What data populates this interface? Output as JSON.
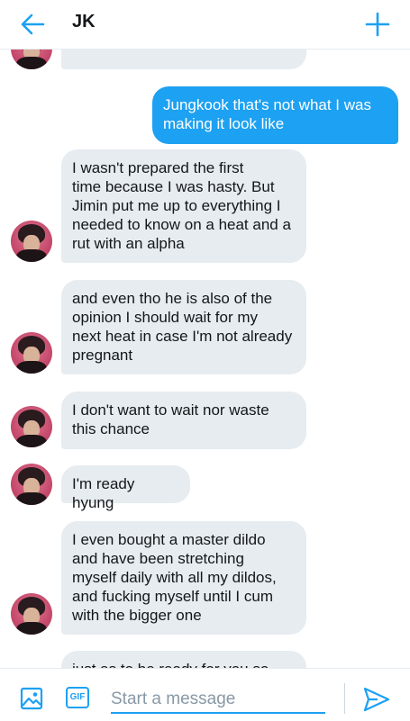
{
  "header": {
    "title": "JK"
  },
  "messages": [
    {
      "dir": "in",
      "text": ""
    },
    {
      "dir": "out",
      "text": "Jungkook that's not what I was\nmaking it look like"
    },
    {
      "dir": "in",
      "text": "I wasn't prepared the first\ntime because I was hasty. But\nJimin put me up to everything I\nneeded to know on a heat and a\nrut with an alpha"
    },
    {
      "dir": "in",
      "text": "and even tho he is also of the\nopinion I should wait for my\nnext heat in case I'm not already\npregnant"
    },
    {
      "dir": "in",
      "text": "I don't want to wait nor waste\nthis chance"
    },
    {
      "dir": "in",
      "text": "I'm ready hyung"
    },
    {
      "dir": "in",
      "text": "I even bought a master dildo\nand have been stretching\nmyself daily with all my dildos,\nand fucking myself until I cum\nwith the bigger one"
    },
    {
      "dir": "in",
      "text": "just as to be ready for you so"
    }
  ],
  "composer": {
    "gif_label": "GIF",
    "placeholder": "Start a message"
  },
  "colors": {
    "accent": "#1da1f2",
    "incoming_bubble": "#e6ecf0"
  },
  "icons": [
    "arrow-left-icon",
    "plus-icon",
    "image-icon",
    "send-icon"
  ]
}
